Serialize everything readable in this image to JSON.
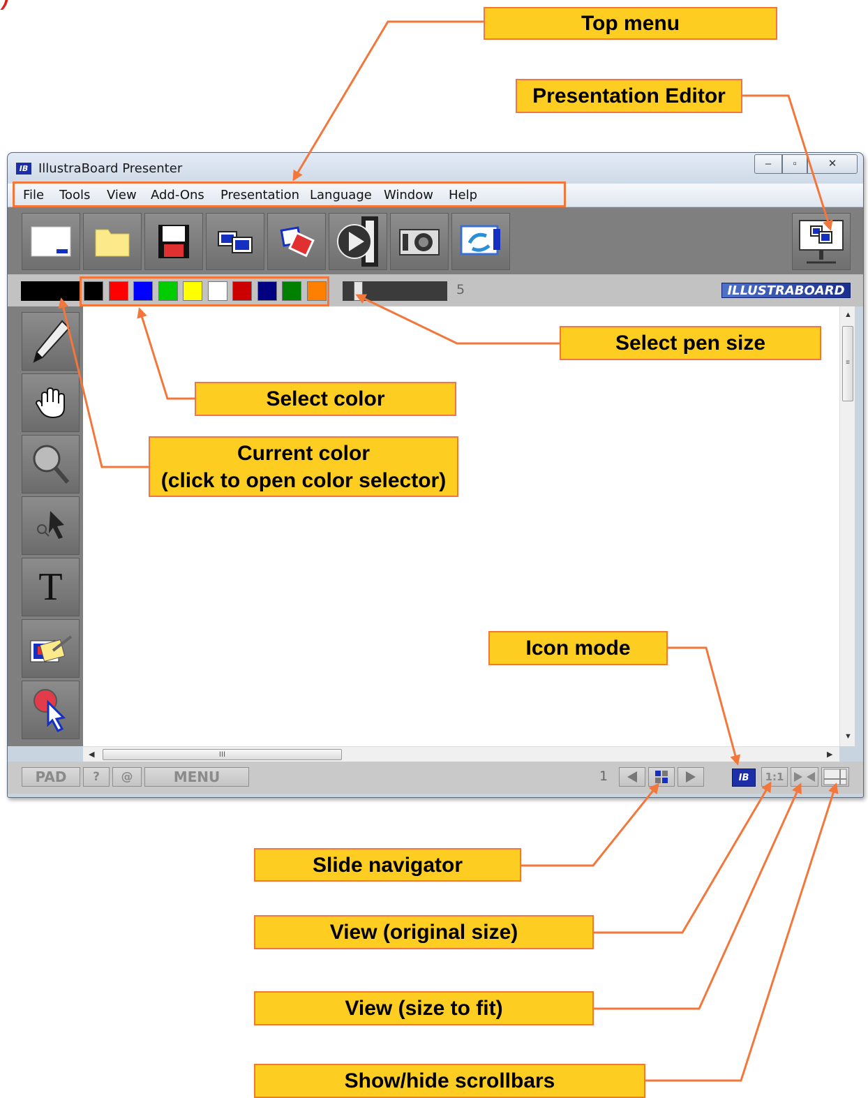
{
  "page_fragment": ")",
  "window": {
    "title": "IllustraBoard Presenter",
    "app_icon_text": "IB",
    "controls": {
      "minimize": "–",
      "maximize": "▫",
      "close": "✕"
    }
  },
  "menu": [
    "File",
    "Tools",
    "View",
    "Add-Ons",
    "Presentation",
    "Language",
    "Window",
    "Help"
  ],
  "toolbar": {
    "buttons": [
      "new-page",
      "open-folder",
      "save-disk",
      "presentation-slides",
      "slide-transition",
      "play-film",
      "camera",
      "screen-capture"
    ],
    "presentation_editor": "presentation-editor-monitor"
  },
  "colorbar": {
    "current_color": "#000000",
    "palette": [
      "#000000",
      "#ff0000",
      "#0000ff",
      "#00cc00",
      "#ffff00",
      "#ffffff",
      "#cc0000",
      "#000080",
      "#008000",
      "#ff8000"
    ],
    "pen_size": "5",
    "pen_size_fraction": 0.05,
    "brand": "ILLUSTRABOARD"
  },
  "sidebar_tools": [
    "pen",
    "hand",
    "magnifier",
    "select",
    "text",
    "eraser",
    "pointer"
  ],
  "text_tool_glyph": "T",
  "scrollbar": {
    "grip": "III",
    "grip_v": "≡"
  },
  "statusbar": {
    "pad": "PAD",
    "help": "?",
    "at": "@",
    "menu": "MENU",
    "slide_number": "1",
    "icon_mode": "IB",
    "original_size": "1:1"
  },
  "callouts": {
    "top_menu": "Top menu",
    "presentation_editor": "Presentation Editor",
    "select_pen_size": "Select pen size",
    "select_color": "Select color",
    "current_color_line1": "Current color",
    "current_color_line2": "(click to open color selector)",
    "icon_mode": "Icon mode",
    "slide_navigator": "Slide navigator",
    "view_original": "View (original size)",
    "view_fit": "View (size to fit)",
    "show_hide_scrollbars": "Show/hide scrollbars"
  },
  "colors": {
    "callout_fill": "#fecd22",
    "callout_border": "#f3763a",
    "highlight": "#f3763a",
    "toolbar_gray": "#7f7f7f"
  }
}
